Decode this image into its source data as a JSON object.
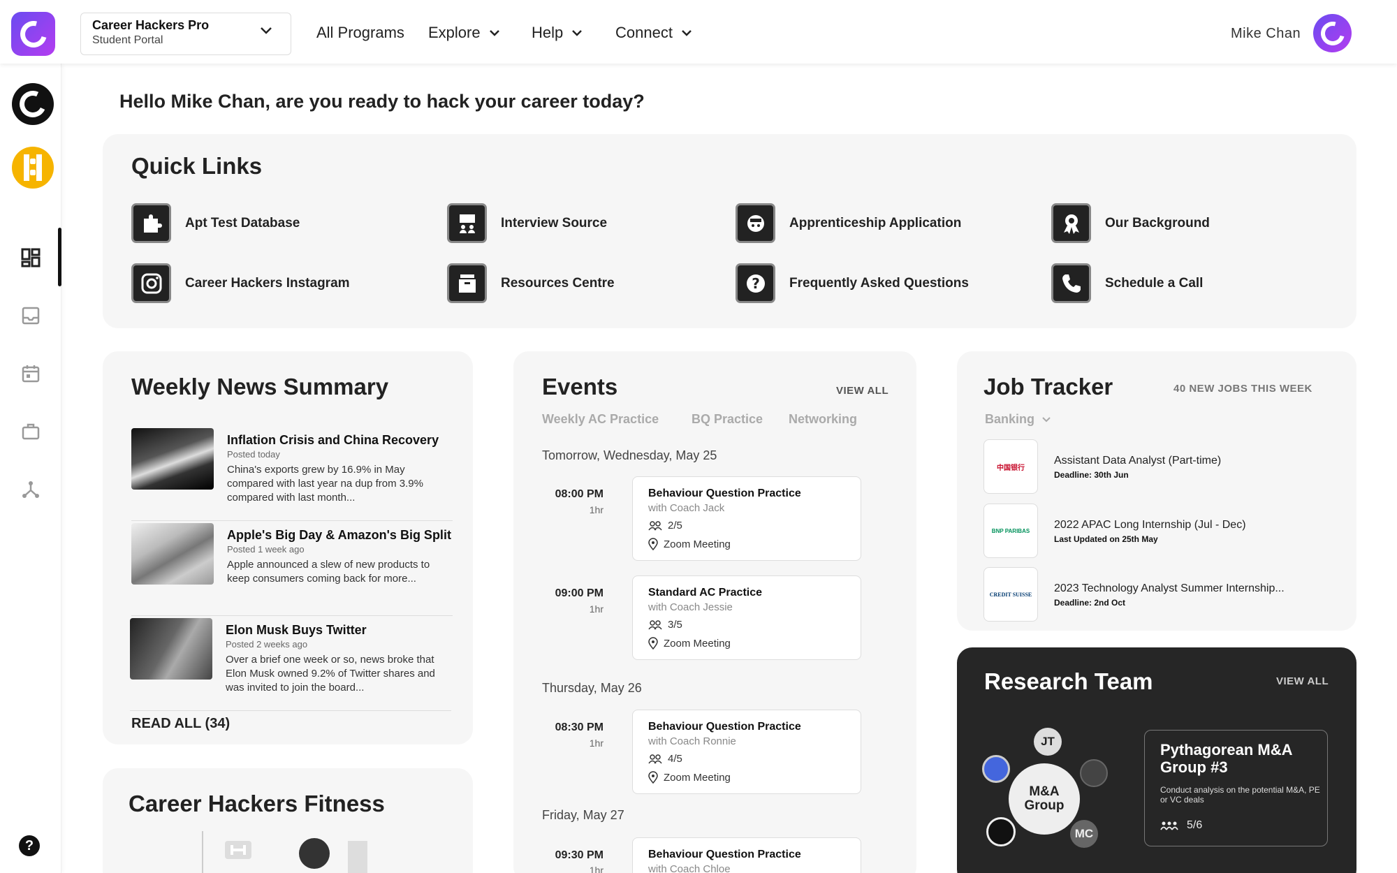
{
  "header": {
    "program_title": "Career Hackers Pro",
    "program_subtitle": "Student Portal",
    "nav": {
      "all_programs": "All Programs",
      "explore": "Explore",
      "help": "Help",
      "connect": "Connect"
    },
    "user_name": "Mike Chan"
  },
  "greeting": "Hello Mike Chan, are you ready to hack your career today?",
  "quick_links": {
    "title": "Quick Links",
    "items": [
      {
        "label": "Apt Test Database",
        "icon": "puzzle-icon"
      },
      {
        "label": "Interview Source",
        "icon": "interview-icon"
      },
      {
        "label": "Apprenticeship Application",
        "icon": "apprentice-icon"
      },
      {
        "label": "Our Background",
        "icon": "award-icon"
      },
      {
        "label": "Career Hackers Instagram",
        "icon": "instagram-icon"
      },
      {
        "label": "Resources Centre",
        "icon": "archive-icon"
      },
      {
        "label": "Frequently Asked Questions",
        "icon": "question-icon"
      },
      {
        "label": "Schedule a Call",
        "icon": "phone-icon"
      }
    ]
  },
  "news": {
    "title": "Weekly News Summary",
    "items": [
      {
        "title": "Inflation Crisis and China Recovery",
        "meta": "Posted today",
        "body": "China's exports grew by 16.9% in May compared with last year na dup from 3.9% compared with last month..."
      },
      {
        "title": "Apple's Big Day & Amazon's Big Split",
        "meta": "Posted 1 week ago",
        "body": "Apple announced a slew of new products to keep consumers coming back for more..."
      },
      {
        "title": "Elon Musk Buys Twitter",
        "meta": "Posted 2 weeks ago",
        "body": "Over a brief one week or so, news broke that Elon Musk owned 9.2% of Twitter shares and was invited to join the board..."
      }
    ],
    "read_all": "READ ALL (34)"
  },
  "fitness": {
    "title": "Career Hackers Fitness"
  },
  "events": {
    "title": "Events",
    "view_all": "VIEW ALL",
    "tabs": [
      "Weekly AC Practice",
      "BQ Practice",
      "Networking"
    ],
    "days": [
      {
        "date": "Tomorrow, Wednesday, May 25"
      },
      {
        "date": "Thursday, May 26"
      },
      {
        "date": "Friday, May 27"
      }
    ],
    "items": [
      {
        "time": "08:00 PM",
        "duration": "1hr",
        "title": "Behaviour Question Practice",
        "coach": "with Coach Jack",
        "participants": "2/5",
        "location": "Zoom Meeting"
      },
      {
        "time": "09:00 PM",
        "duration": "1hr",
        "title": "Standard AC Practice",
        "coach": "with Coach Jessie",
        "participants": "3/5",
        "location": "Zoom Meeting"
      },
      {
        "time": "08:30 PM",
        "duration": "1hr",
        "title": "Behaviour Question Practice",
        "coach": "with Coach Ronnie",
        "participants": "4/5",
        "location": "Zoom Meeting"
      },
      {
        "time": "09:30 PM",
        "duration": "1hr",
        "title": "Behaviour Question Practice",
        "coach": "with Coach Chloe"
      }
    ]
  },
  "jobs": {
    "title": "Job Tracker",
    "new_jobs": "40 NEW JOBS THIS WEEK",
    "filter": "Banking",
    "items": [
      {
        "title": "Assistant Data Analyst (Part-time)",
        "sub": "Deadline: 30th Jun",
        "logo": "中国银行"
      },
      {
        "title": "2022 APAC Long Internship (Jul - Dec)",
        "sub": "Last Updated on 25th May",
        "logo": "BNP PARIBAS"
      },
      {
        "title": "2023 Technology Analyst Summer Internship...",
        "sub": "Deadline: 2nd Oct",
        "logo": "CREDIT SUISSE"
      }
    ]
  },
  "research": {
    "title": "Research Team",
    "view_all": "VIEW ALL",
    "group_bubble": "M&A Group",
    "member_initials": [
      "JT",
      "MC"
    ],
    "group_name": "Pythagorean M&A Group #3",
    "group_desc": "Conduct analysis on the potential M&A, PE or VC deals",
    "members": "5/6"
  },
  "colors": {
    "brand": "#7b4cf0",
    "accent_yellow": "#f6b400",
    "dark_card": "#262626"
  }
}
